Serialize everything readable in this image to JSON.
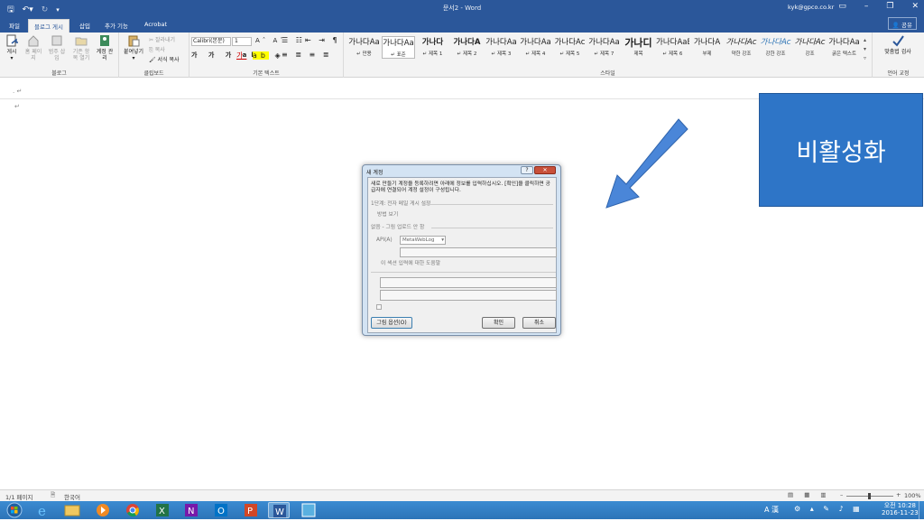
{
  "window": {
    "title": "문서2 - Word",
    "user": "kyk@gpco.co.kr"
  },
  "tabs": [
    "파일",
    "블로그 게시",
    "삽입",
    "추가 기능",
    "Acrobat"
  ],
  "share": "공유",
  "ribbon": {
    "blog": {
      "buttons": [
        "게시",
        "홈 페이지",
        "범주 삽입",
        "기존 항목 열기",
        "계정 관리"
      ],
      "label": "블로그"
    },
    "clipboard": {
      "paste": "붙여넣기",
      "cut": "잘라내기",
      "copy": "복사",
      "format": "서식 복사",
      "label": "클립보드"
    },
    "text": {
      "font": "Calibri(본문)",
      "size": "1",
      "label": "기본 텍스트"
    },
    "styles": {
      "items": [
        {
          "preview": "가나다Aa",
          "name": "↵ 만용"
        },
        {
          "preview": "가나다Aa",
          "name": "↵ 표준"
        },
        {
          "preview": "가나다",
          "name": "↵ 제목 1"
        },
        {
          "preview": "가나다A",
          "name": "↵ 제목 2"
        },
        {
          "preview": "가나다Aa",
          "name": "↵ 제목 3"
        },
        {
          "preview": "가나다Aa",
          "name": "↵ 제목 4"
        },
        {
          "preview": "가나다Ac",
          "name": "↵ 제목 5"
        },
        {
          "preview": "가나다Aa",
          "name": "↵ 제목 7"
        },
        {
          "preview": "가나디",
          "name": "제목"
        },
        {
          "preview": "가나다AaB",
          "name": "↵ 제목 6"
        },
        {
          "preview": "가나다A",
          "name": "부제"
        },
        {
          "preview": "가나다Ac",
          "name": "약한 강조"
        },
        {
          "preview": "가나다Ac",
          "name": "강한 강조"
        },
        {
          "preview": "가나다Ac",
          "name": "강조"
        },
        {
          "preview": "가나다Aa",
          "name": "굵은 텍스트"
        }
      ],
      "label": "스타일"
    },
    "proof": {
      "button": "맞춤법 검사",
      "label": "언어 교정"
    }
  },
  "callout": {
    "text": "비활성화"
  },
  "dialog": {
    "title": "새 계정",
    "intro": "새로 만들기 계정을 등록하려면 아래에 정보를 입력하십시오. [확인]을 클릭하면 공급자에 연결되어 계정 설정이 구성됩니다.",
    "step": "1단계: 전자 메일 게시 설정",
    "how": "방법 보기",
    "section": "없음 - 그림 업로드 안 함",
    "api_label": "API(A)",
    "api_value": "MetaWebLog",
    "help": "이 섹션 입력에 대한 도움말",
    "picture_options": "그림 옵션(O)",
    "ok": "확인",
    "cancel": "취소"
  },
  "status": {
    "page": "1/1 페이지",
    "lang": "한국어",
    "zoom": "100%"
  },
  "tray": {
    "time": "오전 10:28",
    "date": "2016-11-23",
    "ime": "A 漢"
  }
}
